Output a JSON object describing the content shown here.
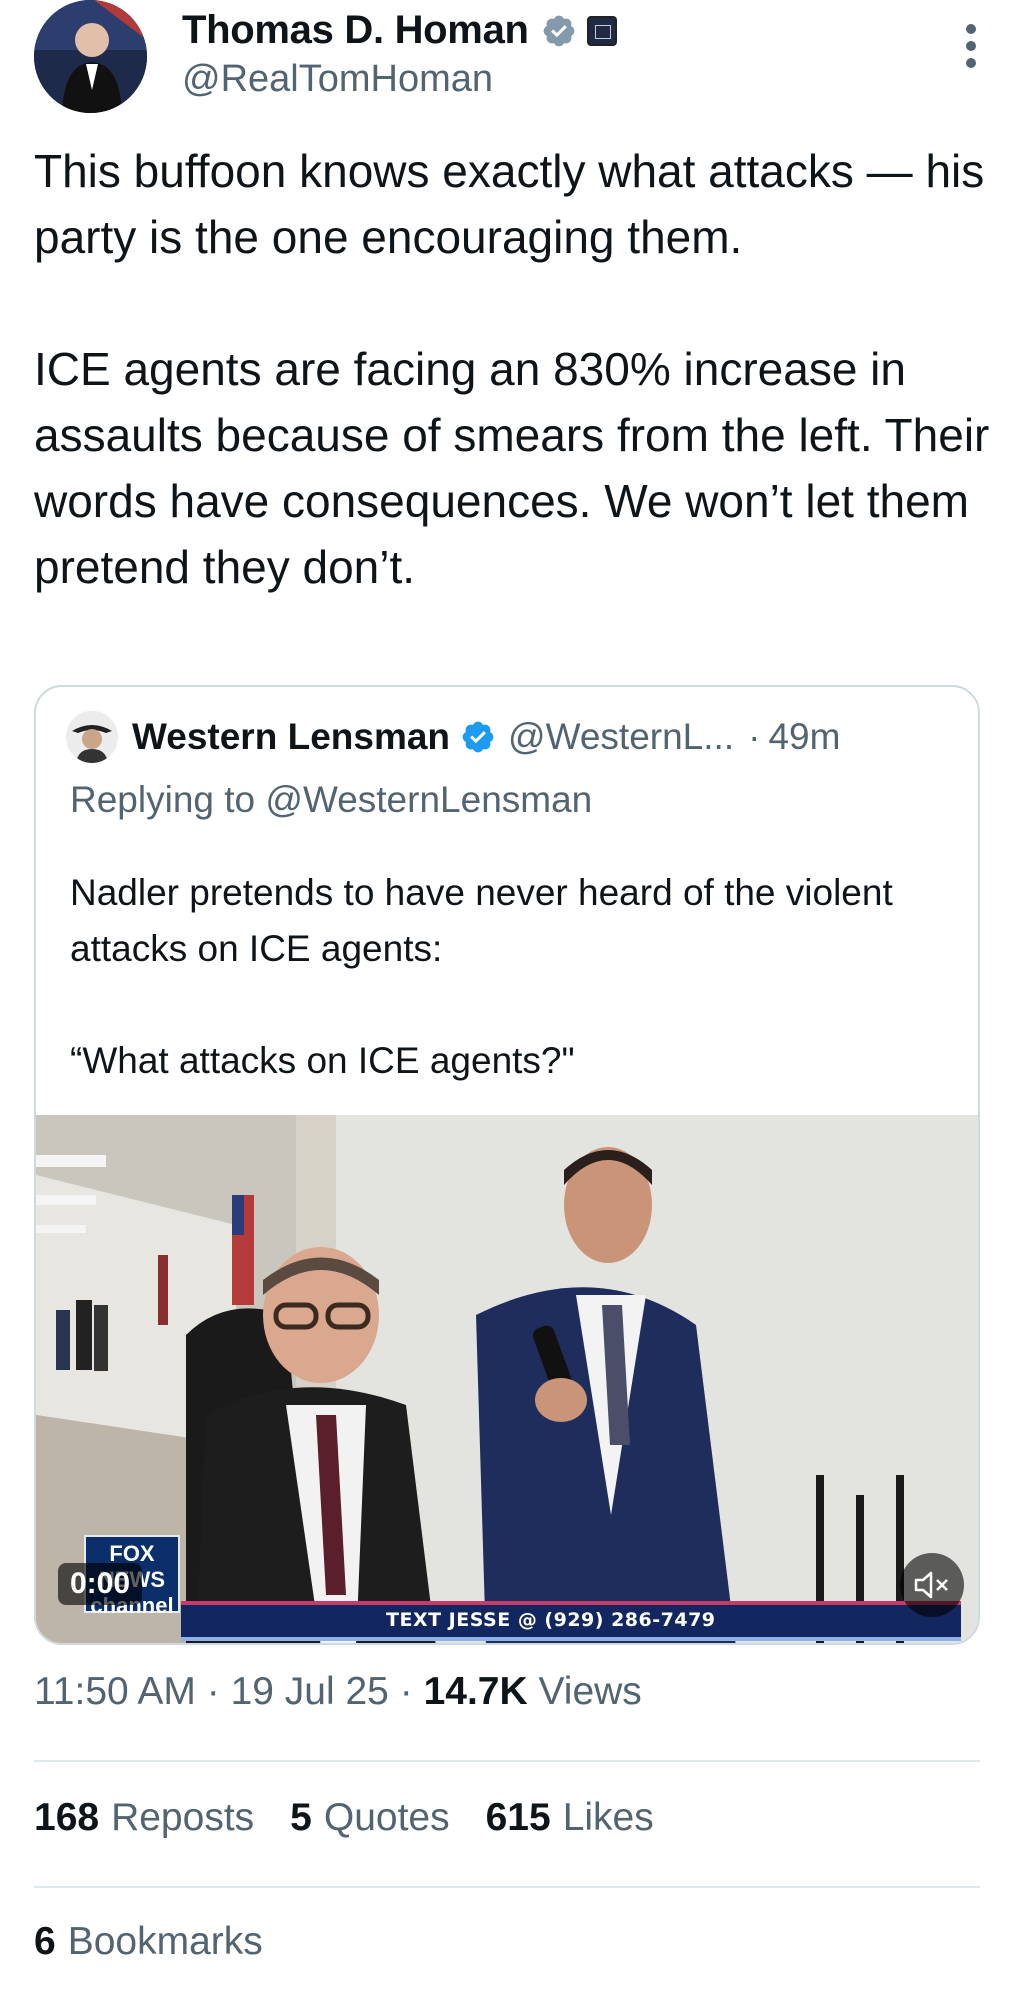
{
  "author": {
    "display_name": "Thomas D. Homan",
    "handle": "@RealTomHoman",
    "avatar_icon": "avatar-photo",
    "verified_icon": "verified-badge-icon",
    "affiliation_icon": "government-affiliation-icon"
  },
  "tweet": {
    "text": "This buffoon knows exactly what attacks — his party is the one encouraging them.\n\nICE agents are facing an 830% increase in assaults because of smears from the left. Their words have consequences. We won’t let them pretend they don’t."
  },
  "quoted_tweet": {
    "display_name": "Western Lensman",
    "handle": "@WesternL...",
    "separator": "·",
    "time": "49m",
    "replying_to": "Replying to @WesternLensman",
    "text": "Nadler pretends to have never heard of the violent attacks on ICE agents:\n\n“What attacks on ICE agents?\"",
    "media": {
      "timestamp": "0:00",
      "ticker": "TEXT JESSE @ (929) 286-7479",
      "logo_text": "FOX NEWS channel",
      "mute_icon": "muted-speaker-icon"
    }
  },
  "meta": {
    "time": "11:50 AM",
    "date": "19 Jul 25",
    "views_count": "14.7K",
    "views_label": "Views",
    "sep": "·"
  },
  "stats": {
    "reposts_count": "168",
    "reposts_label": "Reposts",
    "quotes_count": "5",
    "quotes_label": "Quotes",
    "likes_count": "615",
    "likes_label": "Likes",
    "bookmarks_count": "6",
    "bookmarks_label": "Bookmarks"
  },
  "colors": {
    "text": "#0f1419",
    "secondary": "#536471",
    "verified_blue": "#1d9bf0",
    "verified_gray": "#829aab",
    "border": "#cfd9de"
  }
}
